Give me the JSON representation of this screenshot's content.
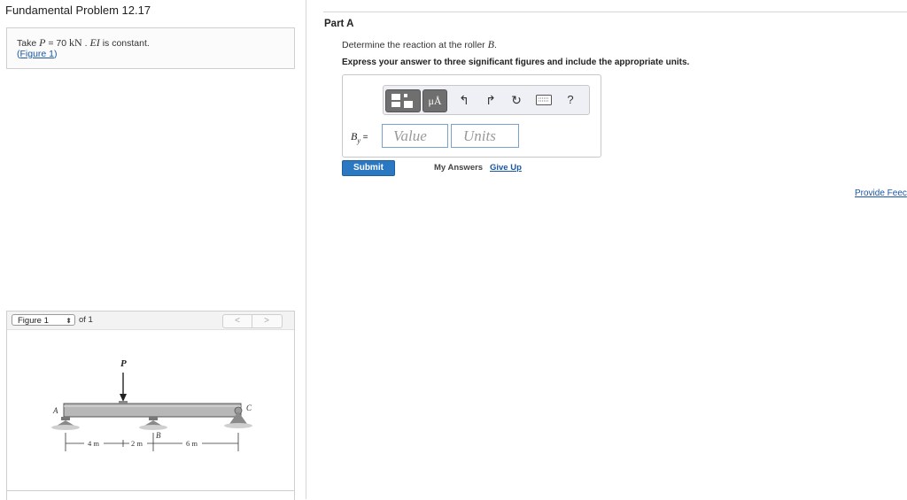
{
  "left": {
    "title": "Fundamental Problem 12.17",
    "problem": {
      "prefix": "Take ",
      "P": "P",
      "equals": " = 70 ",
      "unit": "kN",
      "sep": " . ",
      "EI": "EI",
      "suffix": " is constant.",
      "link_open": "(",
      "link": "Figure 1",
      "link_close": ")"
    },
    "figure": {
      "select_value": "Figure 1",
      "of": "of 1",
      "prev": "<",
      "next": ">",
      "labels": {
        "P": "P",
        "A": "A",
        "B": "B",
        "C": "C",
        "d1": "4 m",
        "d2": "2 m",
        "d3": "6 m"
      }
    }
  },
  "right": {
    "part_label": "Part A",
    "question_prefix": "Determine the reaction at the roller ",
    "question_var": "B",
    "question_suffix": ".",
    "instruction": "Express your answer to three significant figures and include the appropriate units.",
    "toolbar": {
      "mu": "μÅ",
      "help": "?"
    },
    "answer": {
      "var": "B",
      "sub": "y",
      "eq": " =",
      "value_placeholder": "Value",
      "units_placeholder": "Units"
    },
    "submit": "Submit",
    "my_answers": "My Answers",
    "give_up": "Give Up",
    "provide_feedback": "Provide Feec"
  }
}
